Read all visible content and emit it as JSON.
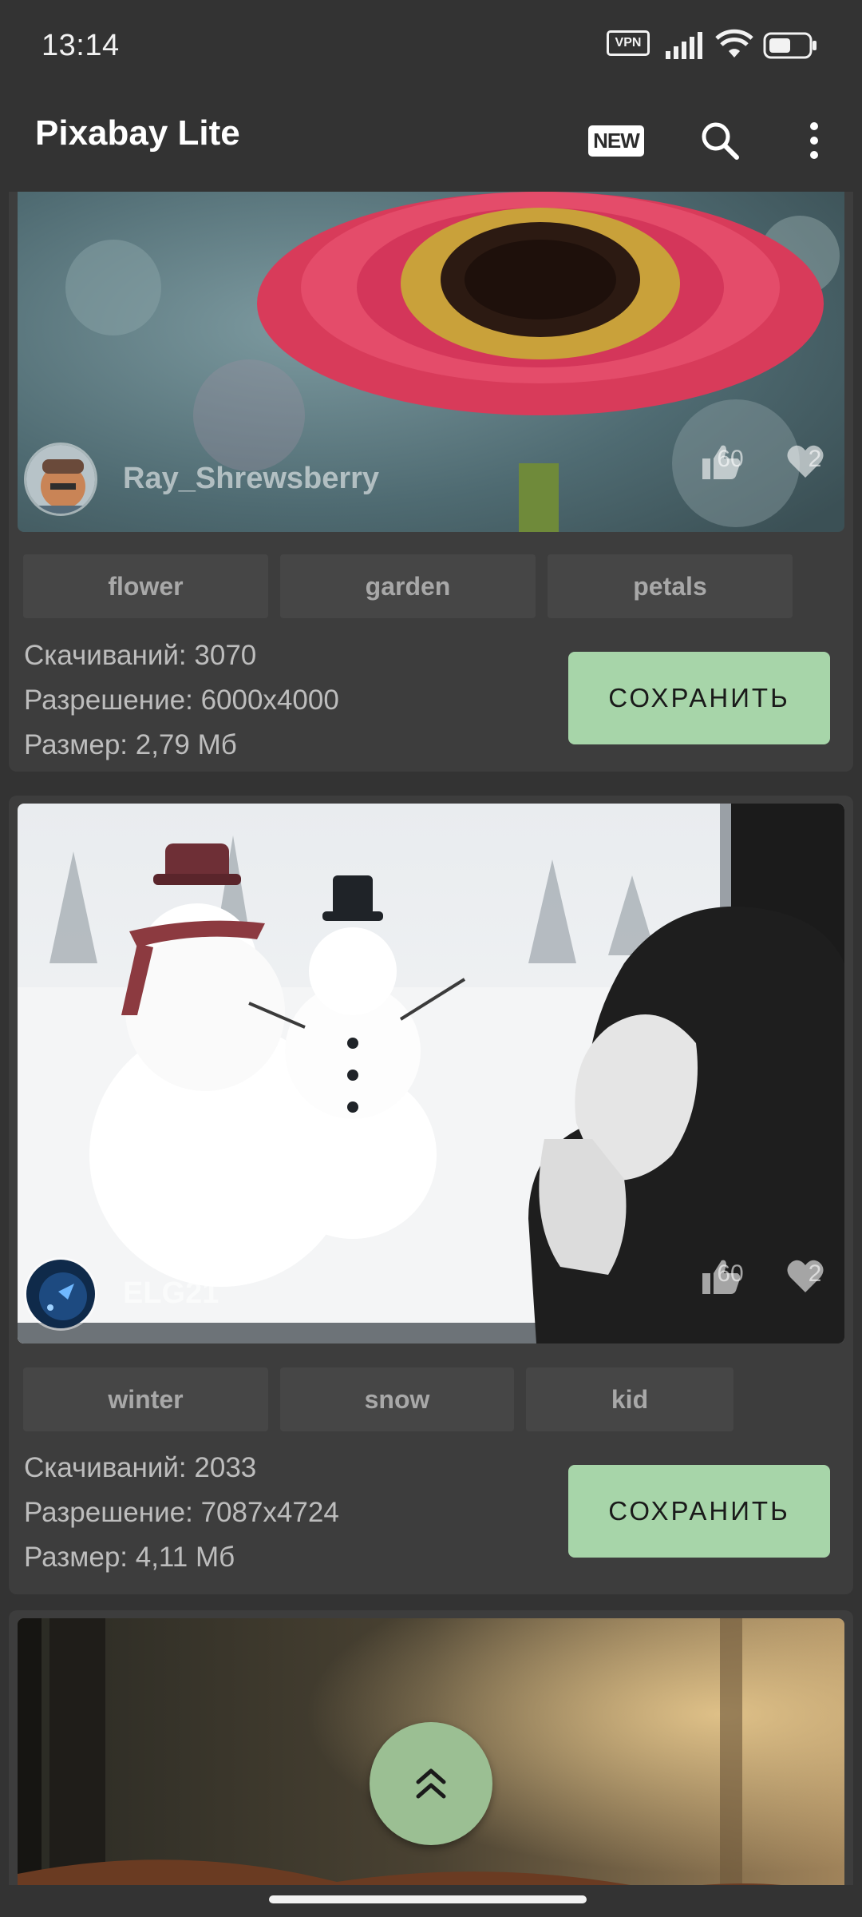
{
  "status_bar": {
    "time": "13:14",
    "vpn_label": "VPN",
    "battery_icon": "battery-icon",
    "wifi_icon": "wifi-icon",
    "signal_icon": "signal-icon"
  },
  "toolbar": {
    "title": "Pixabay Lite",
    "new_label": "NEW",
    "search_icon": "search-icon",
    "more_icon": "more-vert-icon"
  },
  "posts": [
    {
      "author": "Ray_Shrewsberry",
      "likes": "60",
      "favorites": "2",
      "tags": [
        "flower",
        "garden",
        "petals"
      ],
      "downloads": "Скачиваний: 3070",
      "resolution": "Разрешение: 6000x4000",
      "size": "Размер: 2,79 Мб",
      "save_label": "СОХРАНИТЬ"
    },
    {
      "author": "ELG21",
      "likes": "60",
      "favorites": "2",
      "tags": [
        "winter",
        "snow",
        "kid"
      ],
      "downloads": "Скачиваний: 2033",
      "resolution": "Разрешение: 7087x4724",
      "size": "Размер: 4,11 Мб",
      "save_label": "СОХРАНИТЬ"
    }
  ],
  "fab": {
    "icon": "double-chevron-up-icon"
  },
  "colors": {
    "background": "#333333",
    "card": "#3d3d3d",
    "tag": "#464646",
    "save_button": "#a7d5a9",
    "fab": "#9bbf93"
  }
}
